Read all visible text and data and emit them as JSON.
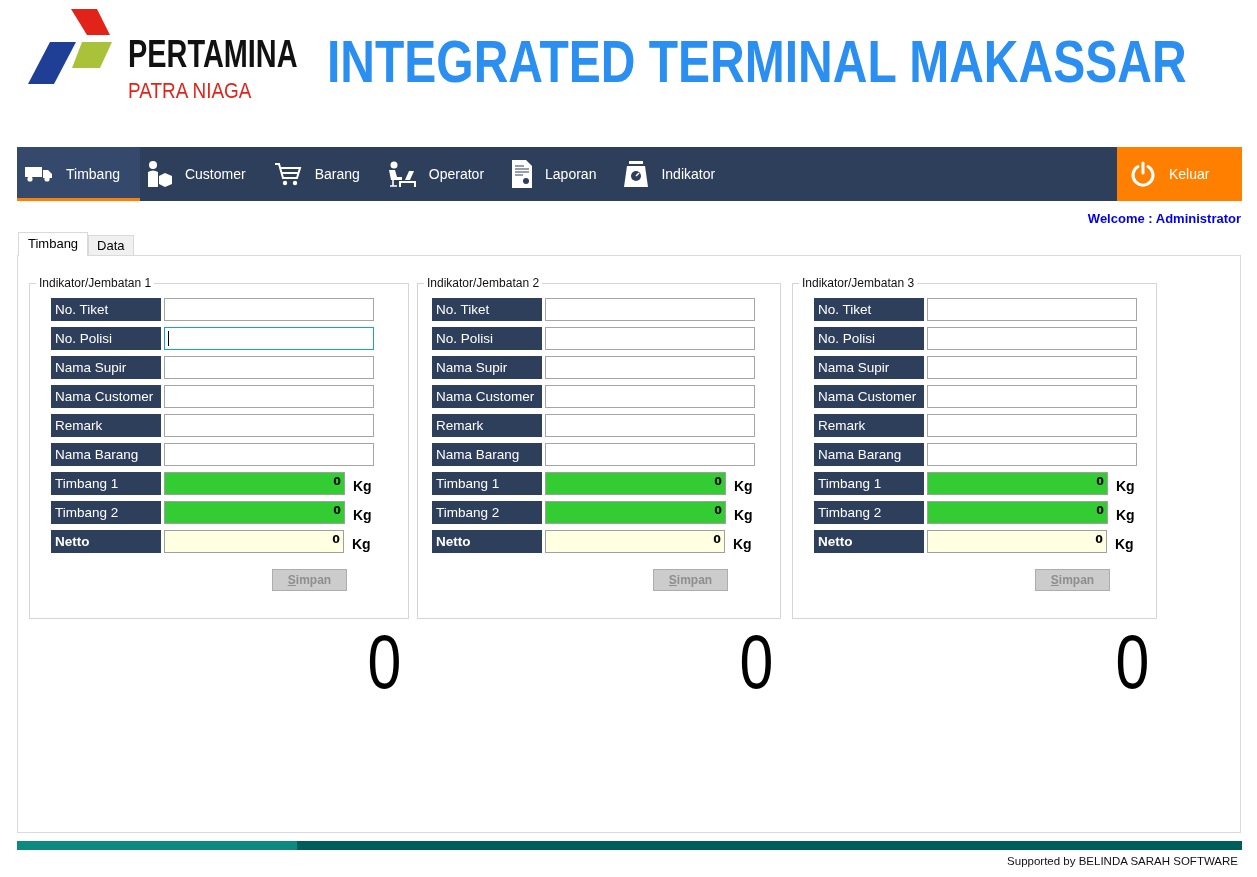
{
  "header": {
    "logo": {
      "wordmark": "PERTAMINA",
      "subtitle": "PATRA NIAGA"
    },
    "title": "INTEGRATED TERMINAL MAKASSAR"
  },
  "menu": {
    "items": [
      {
        "label": "Timbang",
        "selected": true
      },
      {
        "label": "Customer",
        "selected": false
      },
      {
        "label": "Barang",
        "selected": false
      },
      {
        "label": "Operator",
        "selected": false
      },
      {
        "label": "Laporan",
        "selected": false
      },
      {
        "label": "Indikator",
        "selected": false
      }
    ],
    "exit": {
      "label": "Keluar"
    }
  },
  "welcome": "Welcome : Administrator",
  "tabs": [
    {
      "label": "Timbang",
      "selected": true
    },
    {
      "label": "Data",
      "selected": false
    }
  ],
  "bridges": [
    {
      "title": "Indikator/Jembatan 1",
      "fields": [
        {
          "label": "No. Tiket",
          "kind": "text",
          "focused": false
        },
        {
          "label": "No. Polisi",
          "kind": "text",
          "focused": true
        },
        {
          "label": "Nama Supir",
          "kind": "text",
          "focused": false
        },
        {
          "label": "Nama Customer",
          "kind": "text",
          "focused": false
        },
        {
          "label": "Remark",
          "kind": "text",
          "focused": false
        },
        {
          "label": "Nama Barang",
          "kind": "text",
          "focused": false
        },
        {
          "label": "Timbang 1",
          "kind": "weight",
          "value": "0",
          "unit": "Kg"
        },
        {
          "label": "Timbang 2",
          "kind": "weight",
          "value": "0",
          "unit": "Kg"
        },
        {
          "label": "Netto",
          "kind": "net",
          "value": "0",
          "unit": "Kg"
        }
      ],
      "button": {
        "label": "Simpan",
        "disabled": true
      },
      "display": "0"
    },
    {
      "title": "Indikator/Jembatan 2",
      "fields": [
        {
          "label": "No. Tiket",
          "kind": "text",
          "focused": false
        },
        {
          "label": "No. Polisi",
          "kind": "text",
          "focused": false
        },
        {
          "label": "Nama Supir",
          "kind": "text",
          "focused": false
        },
        {
          "label": "Nama Customer",
          "kind": "text",
          "focused": false
        },
        {
          "label": "Remark",
          "kind": "text",
          "focused": false
        },
        {
          "label": "Nama Barang",
          "kind": "text",
          "focused": false
        },
        {
          "label": "Timbang 1",
          "kind": "weight",
          "value": "0",
          "unit": "Kg"
        },
        {
          "label": "Timbang 2",
          "kind": "weight",
          "value": "0",
          "unit": "Kg"
        },
        {
          "label": "Netto",
          "kind": "net",
          "value": "0",
          "unit": "Kg"
        }
      ],
      "button": {
        "label": "Simpan",
        "disabled": true
      },
      "display": "0"
    },
    {
      "title": "Indikator/Jembatan 3",
      "fields": [
        {
          "label": "No. Tiket",
          "kind": "text",
          "focused": false
        },
        {
          "label": "No. Polisi",
          "kind": "text",
          "focused": false
        },
        {
          "label": "Nama Supir",
          "kind": "text",
          "focused": false
        },
        {
          "label": "Nama Customer",
          "kind": "text",
          "focused": false
        },
        {
          "label": "Remark",
          "kind": "text",
          "focused": false
        },
        {
          "label": "Nama Barang",
          "kind": "text",
          "focused": false
        },
        {
          "label": "Timbang 1",
          "kind": "weight",
          "value": "0",
          "unit": "Kg"
        },
        {
          "label": "Timbang 2",
          "kind": "weight",
          "value": "0",
          "unit": "Kg"
        },
        {
          "label": "Netto",
          "kind": "net",
          "value": "0",
          "unit": "Kg"
        }
      ],
      "button": {
        "label": "Simpan",
        "disabled": true
      },
      "display": "0"
    }
  ],
  "footer": {
    "credit": "Supported by BELINDA SARAH SOFTWARE"
  }
}
